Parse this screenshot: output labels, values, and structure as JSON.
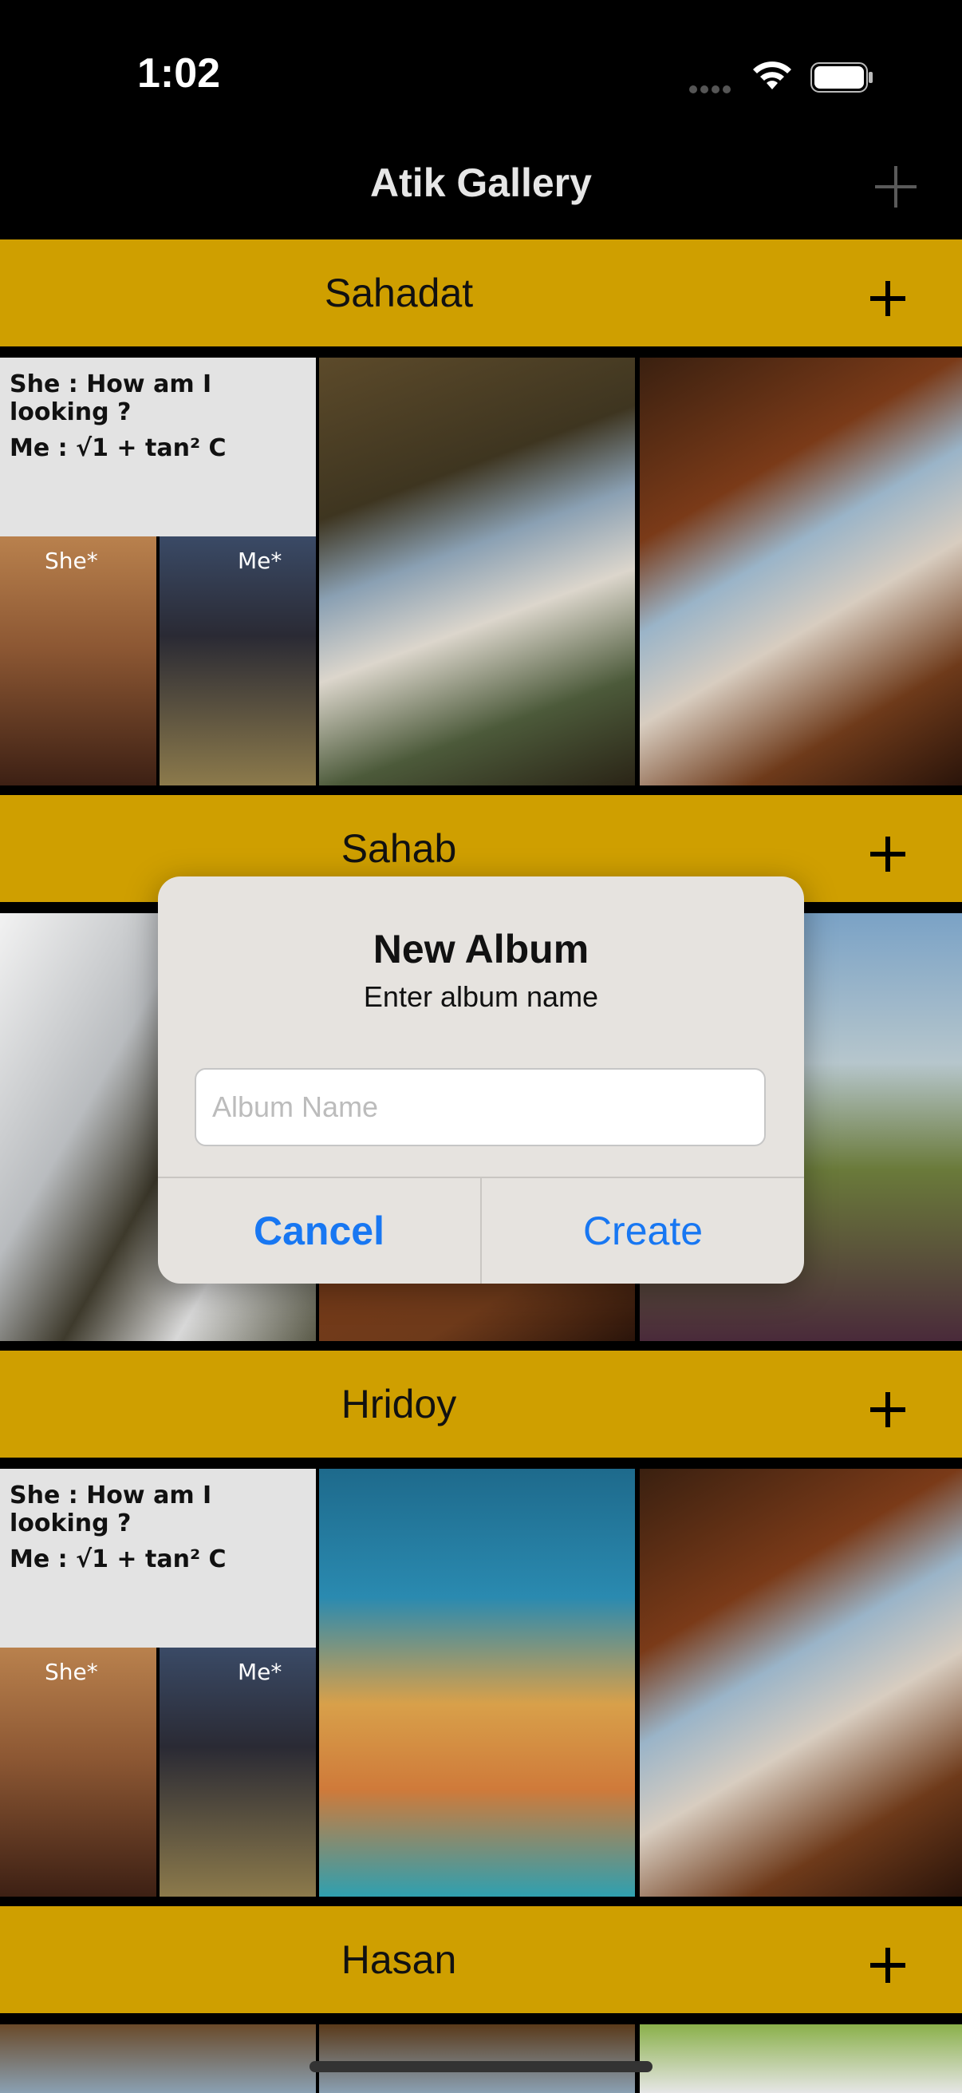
{
  "status_bar": {
    "time": "1:02"
  },
  "nav": {
    "title": "Atik Gallery",
    "add_icon": "plus-icon"
  },
  "albums": [
    {
      "name": "Sahadat"
    },
    {
      "name": "Sahab"
    },
    {
      "name": "Hridoy"
    },
    {
      "name": "Hasan"
    }
  ],
  "meme": {
    "line1": "She : How am I looking ?",
    "line2": "Me : √1 + tan² C",
    "left_caption": "She*",
    "right_caption": "Me*"
  },
  "dialog": {
    "title": "New Album",
    "message": "Enter album name",
    "input_placeholder": "Album Name",
    "input_value": "",
    "cancel_label": "Cancel",
    "create_label": "Create"
  },
  "colors": {
    "album_header": "#cf9f00",
    "action_blue": "#1877f2",
    "background": "#000000"
  }
}
